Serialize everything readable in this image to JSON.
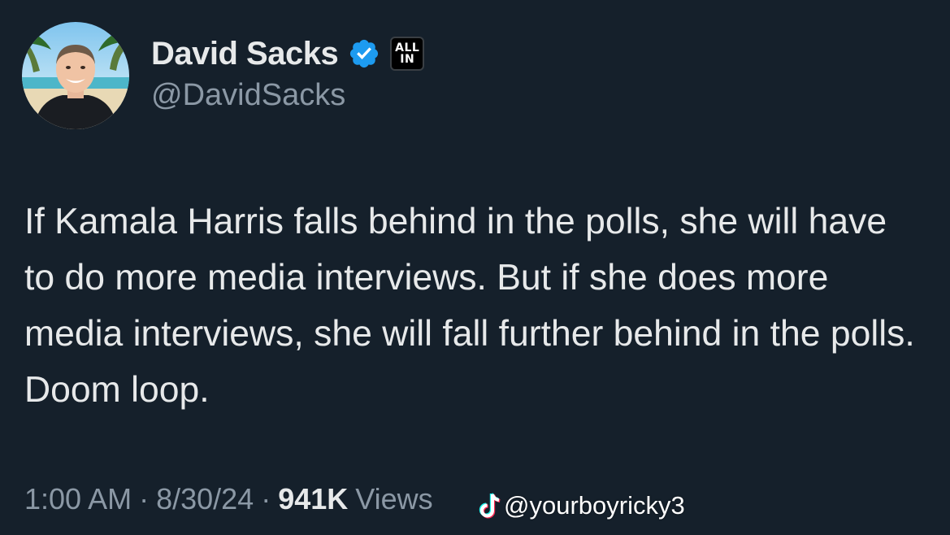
{
  "author": {
    "display_name": "David Sacks",
    "handle": "@DavidSacks",
    "verified_icon": "verified-badge-icon",
    "affiliation_badge": {
      "line1": "ALL",
      "line2": "IN"
    }
  },
  "tweet": {
    "text": "If Kamala Harris falls behind in the polls, she will have to do more media interviews. But if she does more media interviews, she will fall further behind in the polls. Doom loop."
  },
  "meta": {
    "time": "1:00 AM",
    "separator": "·",
    "date": "8/30/24",
    "views_count": "941K",
    "views_label": "Views"
  },
  "watermark": {
    "icon": "tiktok-icon",
    "text": "@yourboyricky3"
  },
  "colors": {
    "background": "#15202b",
    "text_primary": "#e7e9ea",
    "text_secondary": "#8b98a5",
    "verified_blue": "#1d9bf0"
  }
}
